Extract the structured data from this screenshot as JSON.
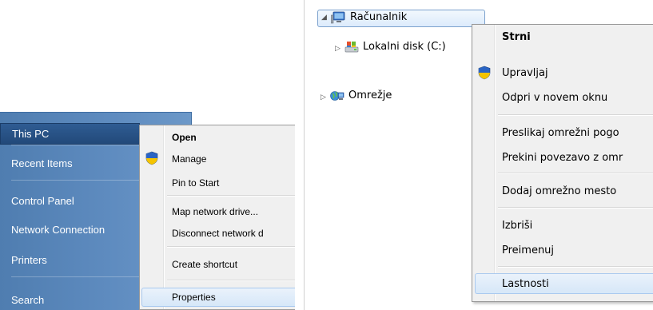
{
  "start_menu": {
    "items": [
      "This PC",
      "Recent Items",
      "Control Panel",
      "Network Connection",
      "Printers",
      "Search"
    ],
    "selected": "This PC"
  },
  "context_menu_en": {
    "items": [
      "Open",
      "Manage",
      "Pin to Start",
      "Map network drive...",
      "Disconnect network d",
      "Create shortcut",
      "Properties"
    ],
    "default_item": "Open",
    "highlighted": "Properties"
  },
  "explorer_tree": {
    "computer": "Računalnik",
    "local_disk": "Lokalni disk (C:)",
    "network": "Omrežje"
  },
  "context_menu_sl": {
    "items": [
      "Strni",
      "Upravljaj",
      "Odpri v novem oknu",
      "Preslikaj omrežni pogo",
      "Prekini povezavo z omr",
      "Dodaj omrežno mesto",
      "Izbriši",
      "Preimenuj",
      "Lastnosti"
    ],
    "default_item": "Strni",
    "highlighted": "Lastnosti"
  },
  "icons": {
    "shield": "uac-shield-icon",
    "computer": "computer-icon",
    "drive": "drive-icon",
    "network": "network-icon"
  },
  "colors": {
    "start_menu_blue": "#5f8cc0",
    "menu_bg": "#f0f0f0",
    "highlight": "#d6e7f8"
  }
}
